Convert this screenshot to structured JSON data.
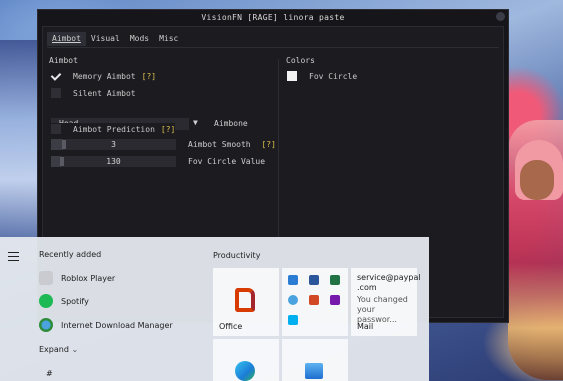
{
  "menu": {
    "title": "VisionFN [RAGE] linora paste",
    "tabs": [
      {
        "label": "Aimbot",
        "active": true
      },
      {
        "label": "Visual",
        "active": false
      },
      {
        "label": "Mods",
        "active": false
      },
      {
        "label": "Misc",
        "active": false
      }
    ],
    "aimbot_group": {
      "title": "Aimbot",
      "memory_aimbot": {
        "label": "Memory Aimbot",
        "hint": "[?]",
        "checked": true
      },
      "silent_aimbot": {
        "label": "Silent Aimbot",
        "checked": false
      },
      "aimbone_value": "Head",
      "aimbone_label": "Aimbone",
      "aimbone_arrow": "▼",
      "prediction": {
        "label": "Aimbot Prediction",
        "hint": "[?]",
        "checked": false
      },
      "smooth": {
        "value": "3",
        "label": "Aimbot Smooth",
        "hint": "[?]"
      },
      "fov": {
        "value": "130",
        "label": "Fov Circle Value"
      }
    },
    "colors_group": {
      "title": "Colors",
      "fov_circle": {
        "label": "Fov Circle",
        "color": "#f2f2f2"
      }
    }
  },
  "start_menu": {
    "recently_added_title": "Recently added",
    "apps": [
      {
        "label": "Roblox Player",
        "icon": "roblox-icon"
      },
      {
        "label": "Spotify",
        "icon": "spotify-icon"
      },
      {
        "label": "Internet Download Manager",
        "icon": "idm-icon"
      }
    ],
    "expand_label": "Expand",
    "expand_chevron": "⌄",
    "hash_label": "#",
    "productivity_title": "Productivity",
    "tiles": {
      "office_label": "Office",
      "mail_label": "Mail",
      "mail_from": "service@paypal",
      "mail_from2": ".com",
      "mail_preview1": "You changed",
      "mail_preview2": "your passwor..."
    }
  },
  "colors": {
    "menu_bg": "#16161a",
    "hint_yellow": "#e0c24e",
    "spotify_green": "#1db954",
    "office_orange": "#d83b01"
  }
}
